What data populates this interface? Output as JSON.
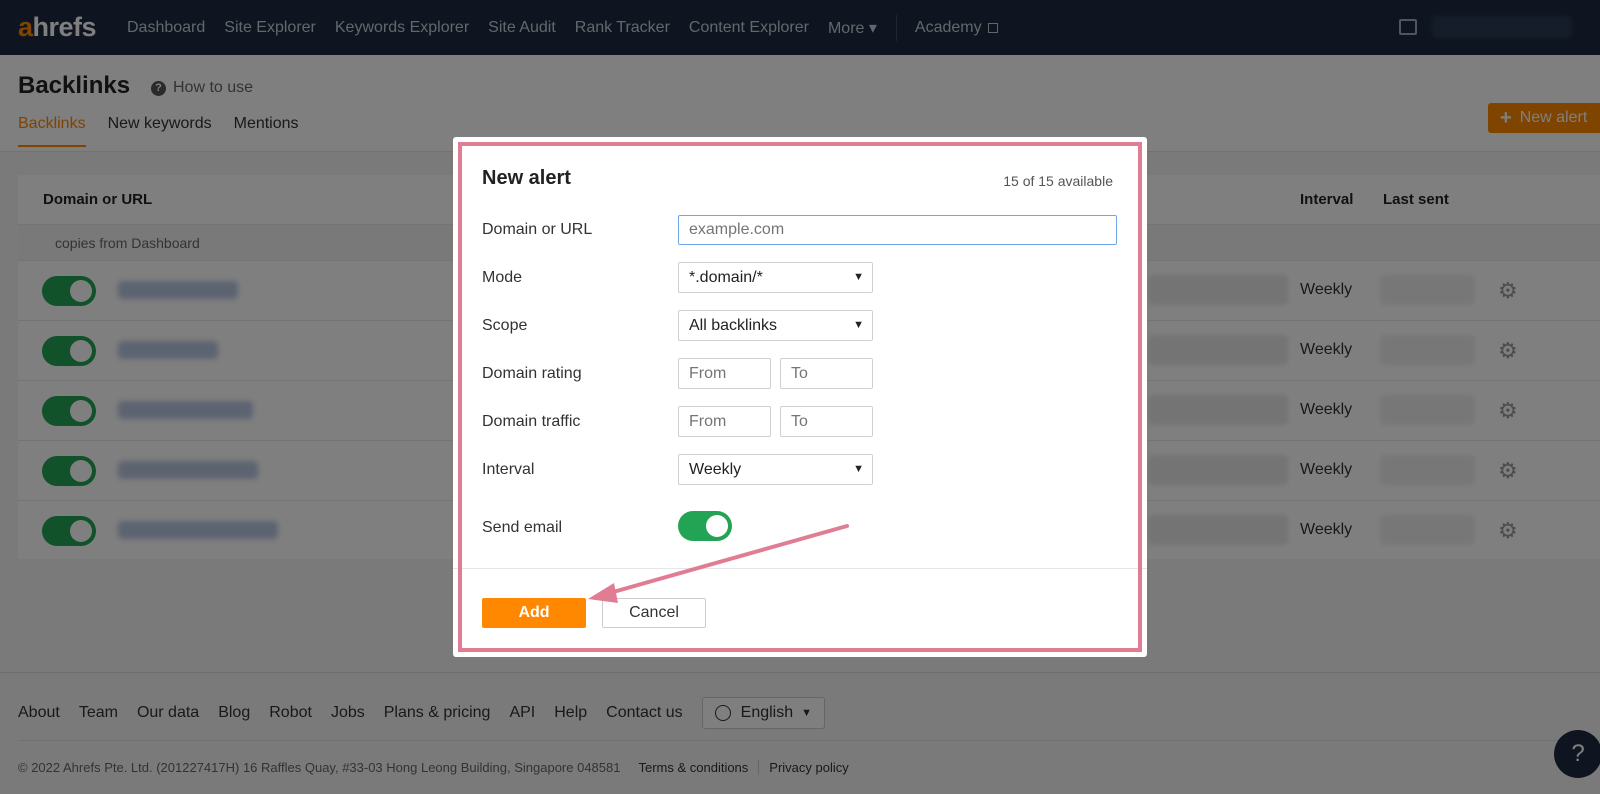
{
  "nav": {
    "logo_a": "a",
    "logo_rest": "hrefs",
    "links": [
      "Dashboard",
      "Site Explorer",
      "Keywords Explorer",
      "Site Audit",
      "Rank Tracker",
      "Content Explorer"
    ],
    "more": "More ▾",
    "academy": "Academy"
  },
  "page": {
    "title": "Backlinks",
    "how_to": "How to use",
    "tabs": [
      "Backlinks",
      "New keywords",
      "Mentions"
    ],
    "new_alert": "New alert"
  },
  "table": {
    "col_domain": "Domain or URL",
    "col_interval": "Interval",
    "col_last_sent": "Last sent",
    "group_label": "copies from Dashboard",
    "rows": [
      {
        "interval": "Weekly"
      },
      {
        "interval": "Weekly"
      },
      {
        "interval": "Weekly"
      },
      {
        "interval": "Weekly"
      },
      {
        "interval": "Weekly"
      }
    ]
  },
  "modal": {
    "title": "New alert",
    "count": "15 of 15 available",
    "label_domain": "Domain or URL",
    "placeholder_domain": "example.com",
    "label_mode": "Mode",
    "mode_value": "*.domain/*",
    "label_scope": "Scope",
    "scope_value": "All backlinks",
    "label_dr": "Domain rating",
    "label_traffic": "Domain traffic",
    "placeholder_from": "From",
    "placeholder_to": "To",
    "label_interval": "Interval",
    "interval_value": "Weekly",
    "label_send_email": "Send email",
    "add": "Add",
    "cancel": "Cancel"
  },
  "footer": {
    "links": [
      "About",
      "Team",
      "Our data",
      "Blog",
      "Robot",
      "Jobs",
      "Plans & pricing",
      "API",
      "Help",
      "Contact us"
    ],
    "language": "English",
    "copyright": "© 2022 Ahrefs Pte. Ltd. (201227417H) 16 Raffles Quay, #33-03 Hong Leong Building, Singapore 048581",
    "terms": "Terms & conditions",
    "privacy": "Privacy policy"
  },
  "colors": {
    "accent": "#ff8800",
    "nav_bg": "#1c2b42",
    "toggle_on": "#23a455",
    "highlight": "#e17d92"
  }
}
